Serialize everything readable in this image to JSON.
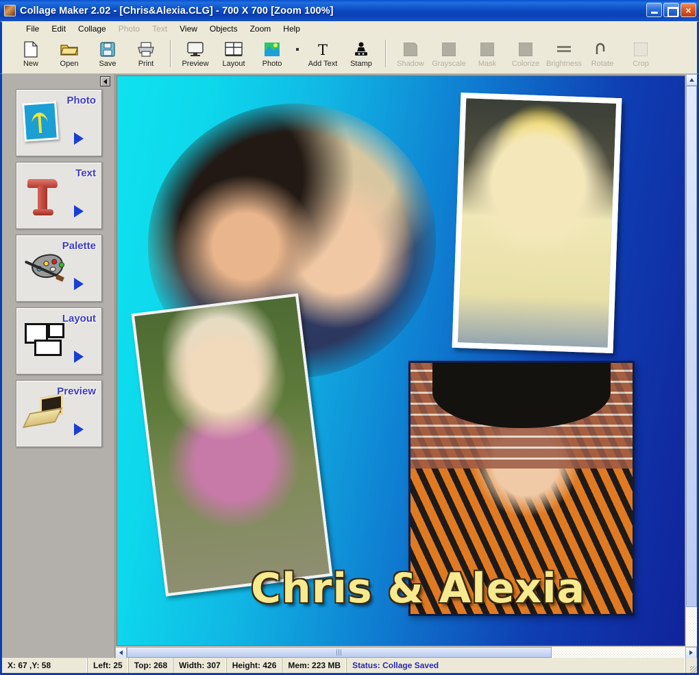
{
  "window": {
    "title": "Collage Maker 2.02  -  [Chris&Alexia.CLG] - 700 X 700  [Zoom 100%]",
    "app_icon": "collage-app-icon",
    "minimize_label": "_",
    "maximize_label": "",
    "close_label": "×"
  },
  "menu": {
    "items": [
      {
        "label": "File",
        "disabled": false
      },
      {
        "label": "Edit",
        "disabled": false
      },
      {
        "label": "Collage",
        "disabled": false
      },
      {
        "label": "Photo",
        "disabled": true
      },
      {
        "label": "Text",
        "disabled": true
      },
      {
        "label": "View",
        "disabled": false
      },
      {
        "label": "Objects",
        "disabled": false
      },
      {
        "label": "Zoom",
        "disabled": false
      },
      {
        "label": "Help",
        "disabled": false
      }
    ]
  },
  "toolbar": {
    "left_group": [
      {
        "label": "New",
        "icon": "new-document-icon",
        "disabled": false
      },
      {
        "label": "Open",
        "icon": "open-folder-icon",
        "disabled": false
      },
      {
        "label": "Save",
        "icon": "floppy-disk-icon",
        "disabled": false
      },
      {
        "label": "Print",
        "icon": "printer-icon",
        "disabled": false
      }
    ],
    "mid_group": [
      {
        "label": "Preview",
        "icon": "monitor-icon",
        "disabled": false
      },
      {
        "label": "Layout",
        "icon": "layout-grid-icon",
        "disabled": false
      },
      {
        "label": "Photo",
        "icon": "photo-thumbnail-icon",
        "disabled": false
      },
      {
        "label": "Add Text",
        "icon": "text-t-icon",
        "disabled": false
      },
      {
        "label": "Stamp",
        "icon": "stamp-icon",
        "disabled": false
      }
    ],
    "right_group": [
      {
        "label": "Shadow",
        "icon": "shadow-icon",
        "disabled": true
      },
      {
        "label": "Grayscale",
        "icon": "grayscale-icon",
        "disabled": true
      },
      {
        "label": "Mask",
        "icon": "mask-icon",
        "disabled": true
      },
      {
        "label": "Colorize",
        "icon": "colorize-icon",
        "disabled": true
      },
      {
        "label": "Brightness",
        "icon": "brightness-icon",
        "disabled": true
      },
      {
        "label": "Rotate",
        "icon": "rotate-icon",
        "disabled": true
      },
      {
        "label": "Crop",
        "icon": "crop-icon",
        "disabled": true
      }
    ]
  },
  "sidebar": {
    "collapse_button": "collapse-panel-arrow",
    "items": [
      {
        "label": "Photo",
        "icon": "photo-card-icon"
      },
      {
        "label": "Text",
        "icon": "text-t-3d-icon"
      },
      {
        "label": "Palette",
        "icon": "palette-brush-icon"
      },
      {
        "label": "Layout",
        "icon": "layout-boxes-icon"
      },
      {
        "label": "Preview",
        "icon": "laptop-preview-icon"
      }
    ]
  },
  "canvas": {
    "collage_title": "Chris & Alexia",
    "background_start_color": "#0fe2ef",
    "background_end_color": "#10239a",
    "title_color": "#f7e98e",
    "photos": [
      {
        "name": "photo-woman-and-baby-oval"
      },
      {
        "name": "photo-baby-with-yellow-hat"
      },
      {
        "name": "photo-girl-in-garden"
      },
      {
        "name": "photo-child-tiger-costume"
      }
    ]
  },
  "scrollbars": {
    "up_arrow": "▲",
    "down_arrow": "▼",
    "left_arrow": "◀",
    "right_arrow": "▶"
  },
  "statusbar": {
    "coords": "X: 67 ,Y: 58",
    "left": "Left: 25",
    "top": "Top: 268",
    "width": "Width: 307",
    "height": "Height: 426",
    "mem": "Mem: 223 MB",
    "status": "Status: Collage Saved",
    "status_color": "#2a2ab0"
  }
}
